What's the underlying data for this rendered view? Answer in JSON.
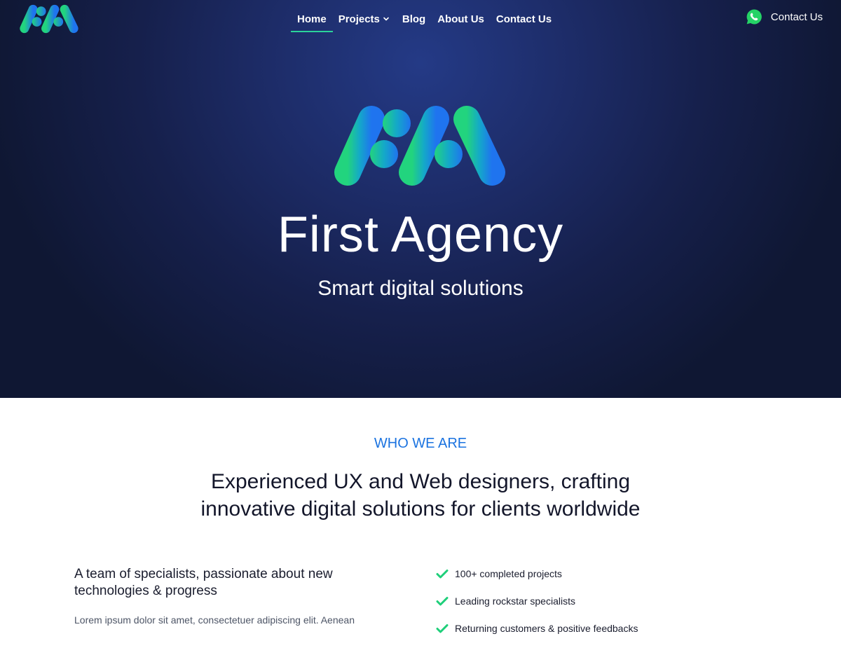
{
  "brand": {
    "logo_text": "FA",
    "gradient_start": "#22d47e",
    "gradient_end": "#1f74ef"
  },
  "nav": {
    "items": [
      {
        "label": "Home",
        "active": true
      },
      {
        "label": "Projects",
        "has_dropdown": true
      },
      {
        "label": "Blog"
      },
      {
        "label": "About Us"
      },
      {
        "label": "Contact Us"
      }
    ],
    "contact_label": "Contact Us",
    "contact_icon": "whatsapp-icon",
    "active_underline_color": "#2bd39a"
  },
  "hero": {
    "title": "First Agency",
    "subtitle": "Smart digital solutions",
    "background_color": "#16204c"
  },
  "about": {
    "eyebrow": "WHO WE ARE",
    "eyebrow_color": "#1b73e0",
    "heading_line1": "Experienced UX and Web designers, crafting",
    "heading_line2": "innovative digital solutions for clients worldwide",
    "lead_line1": "A team of specialists, passionate about new",
    "lead_line2": "technologies & progress",
    "body": "Lorem ipsum dolor sit amet, consectetuer adipiscing elit. Aenean",
    "features": [
      "100+ completed projects",
      "Leading rockstar specialists",
      "Returning customers & positive feedbacks"
    ],
    "check_color": "#1fcf7a",
    "check_icon": "check-icon"
  }
}
